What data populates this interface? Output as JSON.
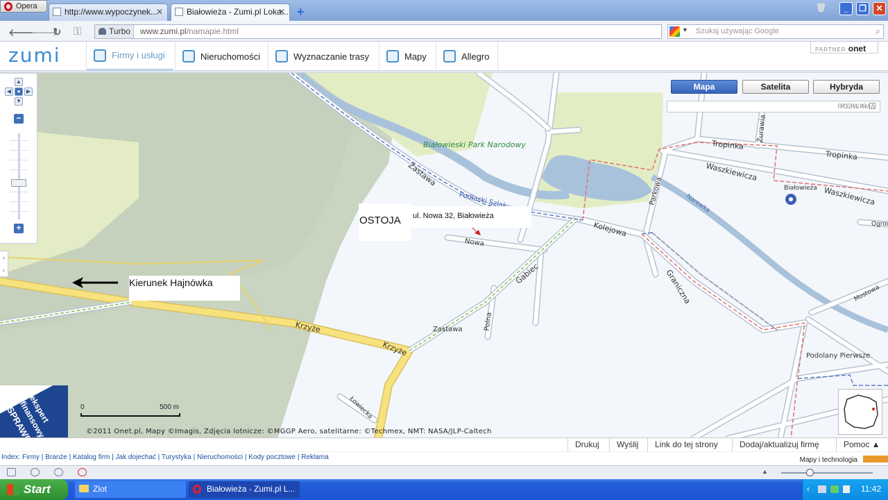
{
  "browser": {
    "opera_label": "Opera",
    "tabs": [
      {
        "title": "http://www.wypoczynek..."
      },
      {
        "title": "Białowieża - Zumi.pl Loka..."
      }
    ],
    "address": {
      "turbo": "Turbo",
      "domain": "www.zumi.pl",
      "path": "/namapie.html"
    },
    "search_placeholder": "Szukaj używając Google"
  },
  "site": {
    "logo": "zumi",
    "menu": [
      {
        "label": "Firmy i usługi"
      },
      {
        "label": "Nieruchomości"
      },
      {
        "label": "Wyznaczanie trasy"
      },
      {
        "label": "Mapy"
      },
      {
        "label": "Allegro"
      }
    ],
    "partner_prefix": "PARTNER",
    "partner_brand": "onet"
  },
  "map": {
    "view_buttons": {
      "map": "Mapa",
      "satellite": "Satelita",
      "hybrid": "Hybryda"
    },
    "ad": {
      "label": "REKLAMA",
      "expand": "ROZWIŃ"
    },
    "labels": {
      "park": "Białowieski Park Narodowy",
      "zastawa_road": "Zastawa",
      "podlaski": "Podlaski Szlak",
      "nowa": "Nowa",
      "gabiec": "Gabiec",
      "polna": "Polna",
      "zastawa_area": "Zastawa",
      "krzyze1": "Krzyże",
      "krzyze2": "Krzyże",
      "lowiecka": "Łowiecka",
      "kolejowa": "Kolejowa",
      "parkowa": "Parkowa",
      "graniczna": "Graniczna",
      "narewka": "Narewka",
      "zurawia": "Żurawia",
      "tropinka1": "Tropinka",
      "tropinka2": "Tropinka",
      "waszkiewicza1": "Waszkiewicza",
      "waszkiewicza2": "Waszkiewicza",
      "bialowieza": "Białowieża",
      "ogrod": "Ogrod",
      "mostowa": "Mostowa",
      "podolany": "Podolany Pierwsze"
    },
    "annotations": {
      "ostoja": "OSTOJA",
      "address": "ul. Nowa 32, Białowieża",
      "direction": "Kierunek Hajnówka"
    },
    "scale": {
      "start": "0",
      "end": "500 m"
    },
    "copyright": "©2011 Onet.pl, Mapy ©Imagis, Zdjęcia lotnicze: ©MGGP Aero, satelitarne: ©Techmex, NMT: NASA/JLP-Caltech",
    "badge_lines": [
      "ekspert",
      "finansowy",
      "SPRAWDŹ"
    ]
  },
  "footer_buttons": [
    "Drukuj",
    "Wyślij",
    "Link do tej strony",
    "Dodaj/aktualizuj firmę",
    "Pomoc ▲"
  ],
  "index_links": "Index: Firmy | Branże | Katalog firm | Jak dojechać | Turystyka | Nieruchomości | Kody pocztowe | Reklama",
  "mapy_tech": "Mapy i technologia",
  "taskbar": {
    "start": "Start",
    "items": [
      {
        "label": "Zlot"
      },
      {
        "label": "Białowieża - Zumi.pl L..."
      }
    ],
    "clock": "11:42"
  },
  "colors": {
    "accent": "#3863b8",
    "water": "#a9c2dc",
    "forest": "#c9d7bd",
    "road_major": "#f7e27d"
  }
}
